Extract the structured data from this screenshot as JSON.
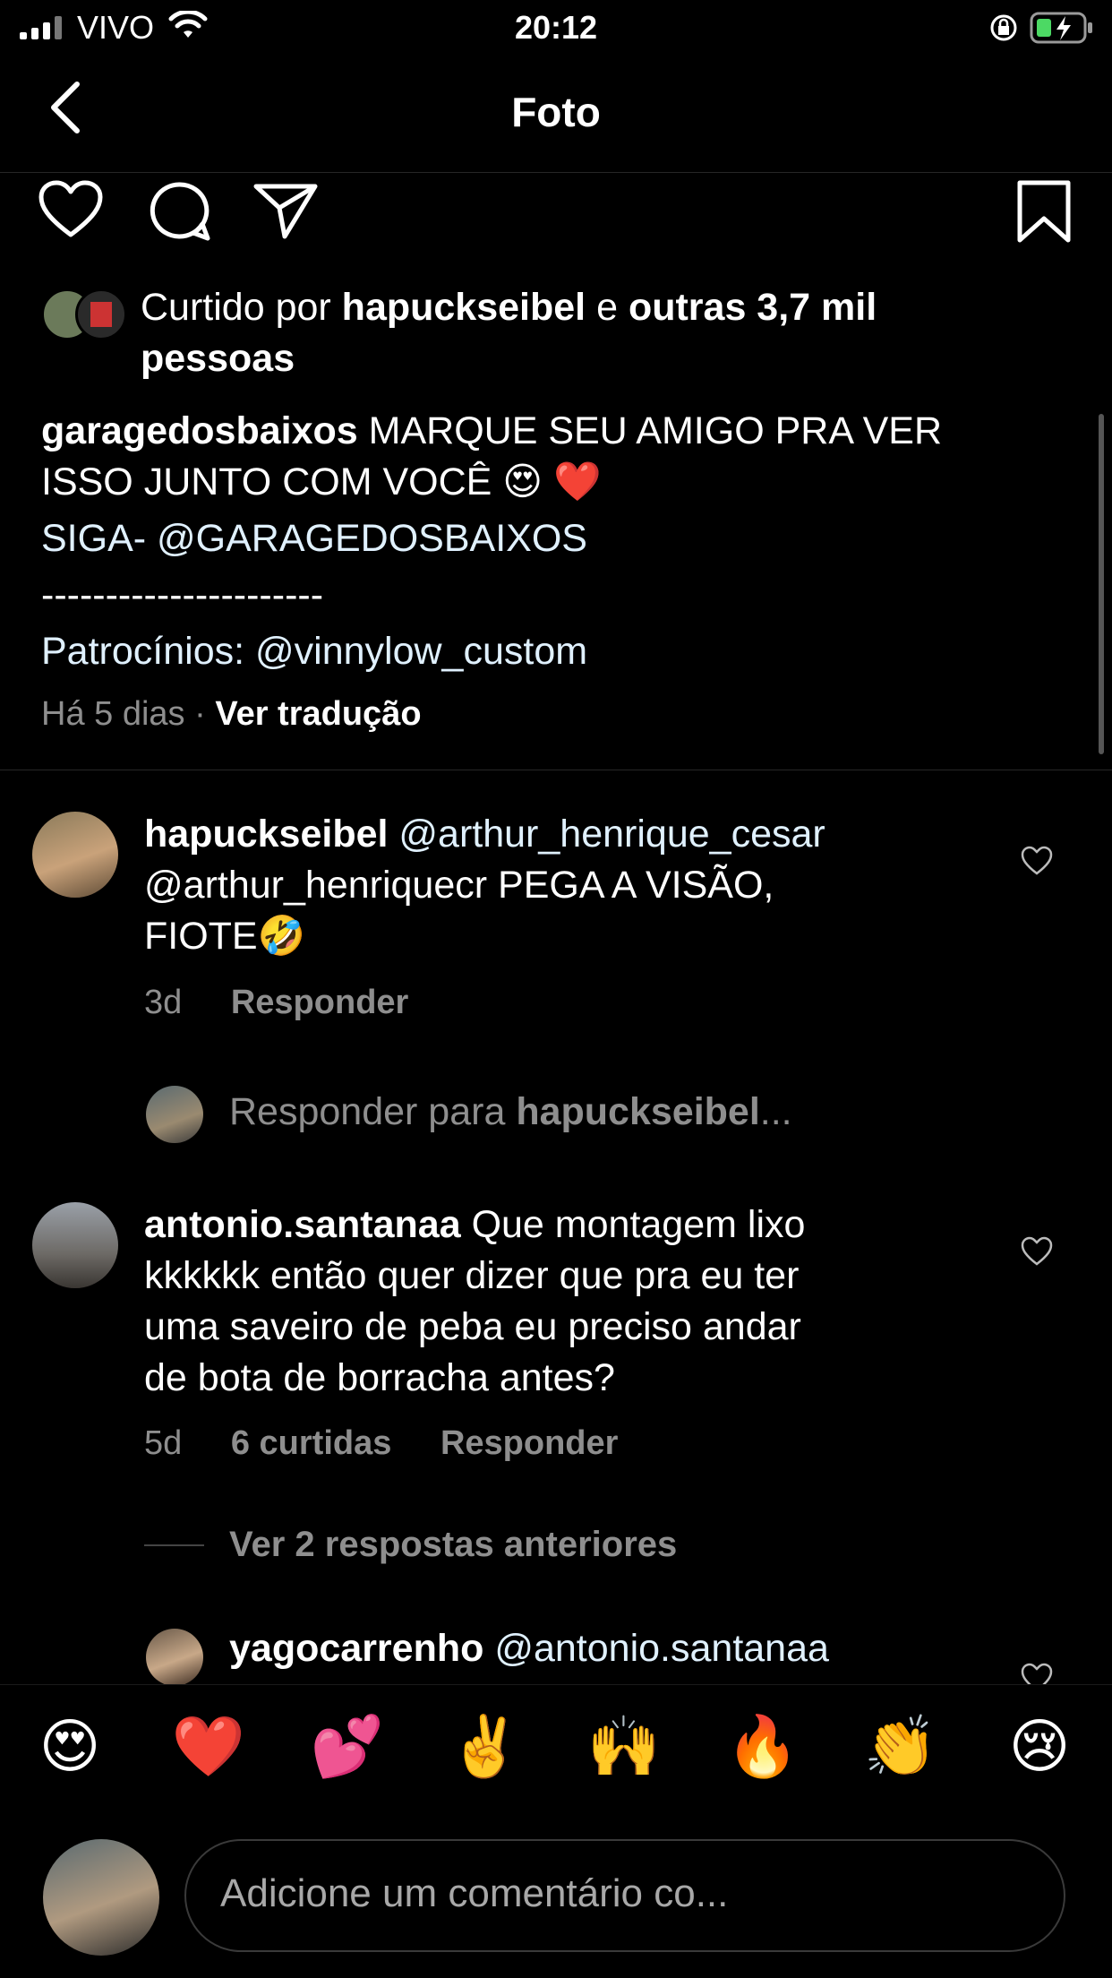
{
  "status_bar": {
    "carrier": "VIVO",
    "time": "20:12"
  },
  "nav": {
    "title": "Foto"
  },
  "icons": {
    "back": "chevron-left-icon",
    "like": "heart-icon",
    "comment": "comment-icon",
    "share": "paper-plane-icon",
    "save": "bookmark-icon"
  },
  "likes": {
    "prefix": "Curtido por ",
    "user": "hapuckseibel",
    "joiner": " e ",
    "others": "outras 3,7 mil",
    "suffix": "pessoas"
  },
  "caption": {
    "username": "garagedosbaixos",
    "line1": " MARQUE SEU AMIGO PRA VER",
    "line2": "ISSO JUNTO COM VOCÊ 😍 ❤️",
    "line3": "SIGA- @GARAGEDOSBAIXOS",
    "line4": "----------------------",
    "line5": "Patrocínios: @vinnylow_custom",
    "time": "Há 5 dias",
    "dot": " · ",
    "translate": "Ver tradução"
  },
  "comments": [
    {
      "username": "hapuckseibel",
      "line1": " @arthur_henrique_cesar",
      "line2": "@arthur_henriquecr  PEGA A VISÃO,",
      "line3": "FIOTE🤣",
      "time": "3d",
      "reply": "Responder",
      "reply_prompt_prefix": "Responder para ",
      "reply_prompt_user": "hapuckseibel",
      "reply_prompt_suffix": "..."
    },
    {
      "username": "antonio.santanaa",
      "line1": " Que montagem lixo",
      "line2": "kkkkkk então quer dizer que pra eu ter",
      "line3": "uma saveiro de peba eu preciso andar",
      "line4": "de bota de borracha antes?",
      "time": "5d",
      "likes": "6 curtidas",
      "reply": "Responder",
      "view_replies": "Ver 2 respostas anteriores"
    },
    {
      "username": "yagocarrenho",
      "line1": " @antonio.santanaa"
    }
  ],
  "emoji_bar": [
    "😍",
    "❤️",
    "💕",
    "✌️",
    "🙌",
    "🔥",
    "👏",
    "😢"
  ],
  "composer": {
    "placeholder": "Adicione um comentário co..."
  }
}
